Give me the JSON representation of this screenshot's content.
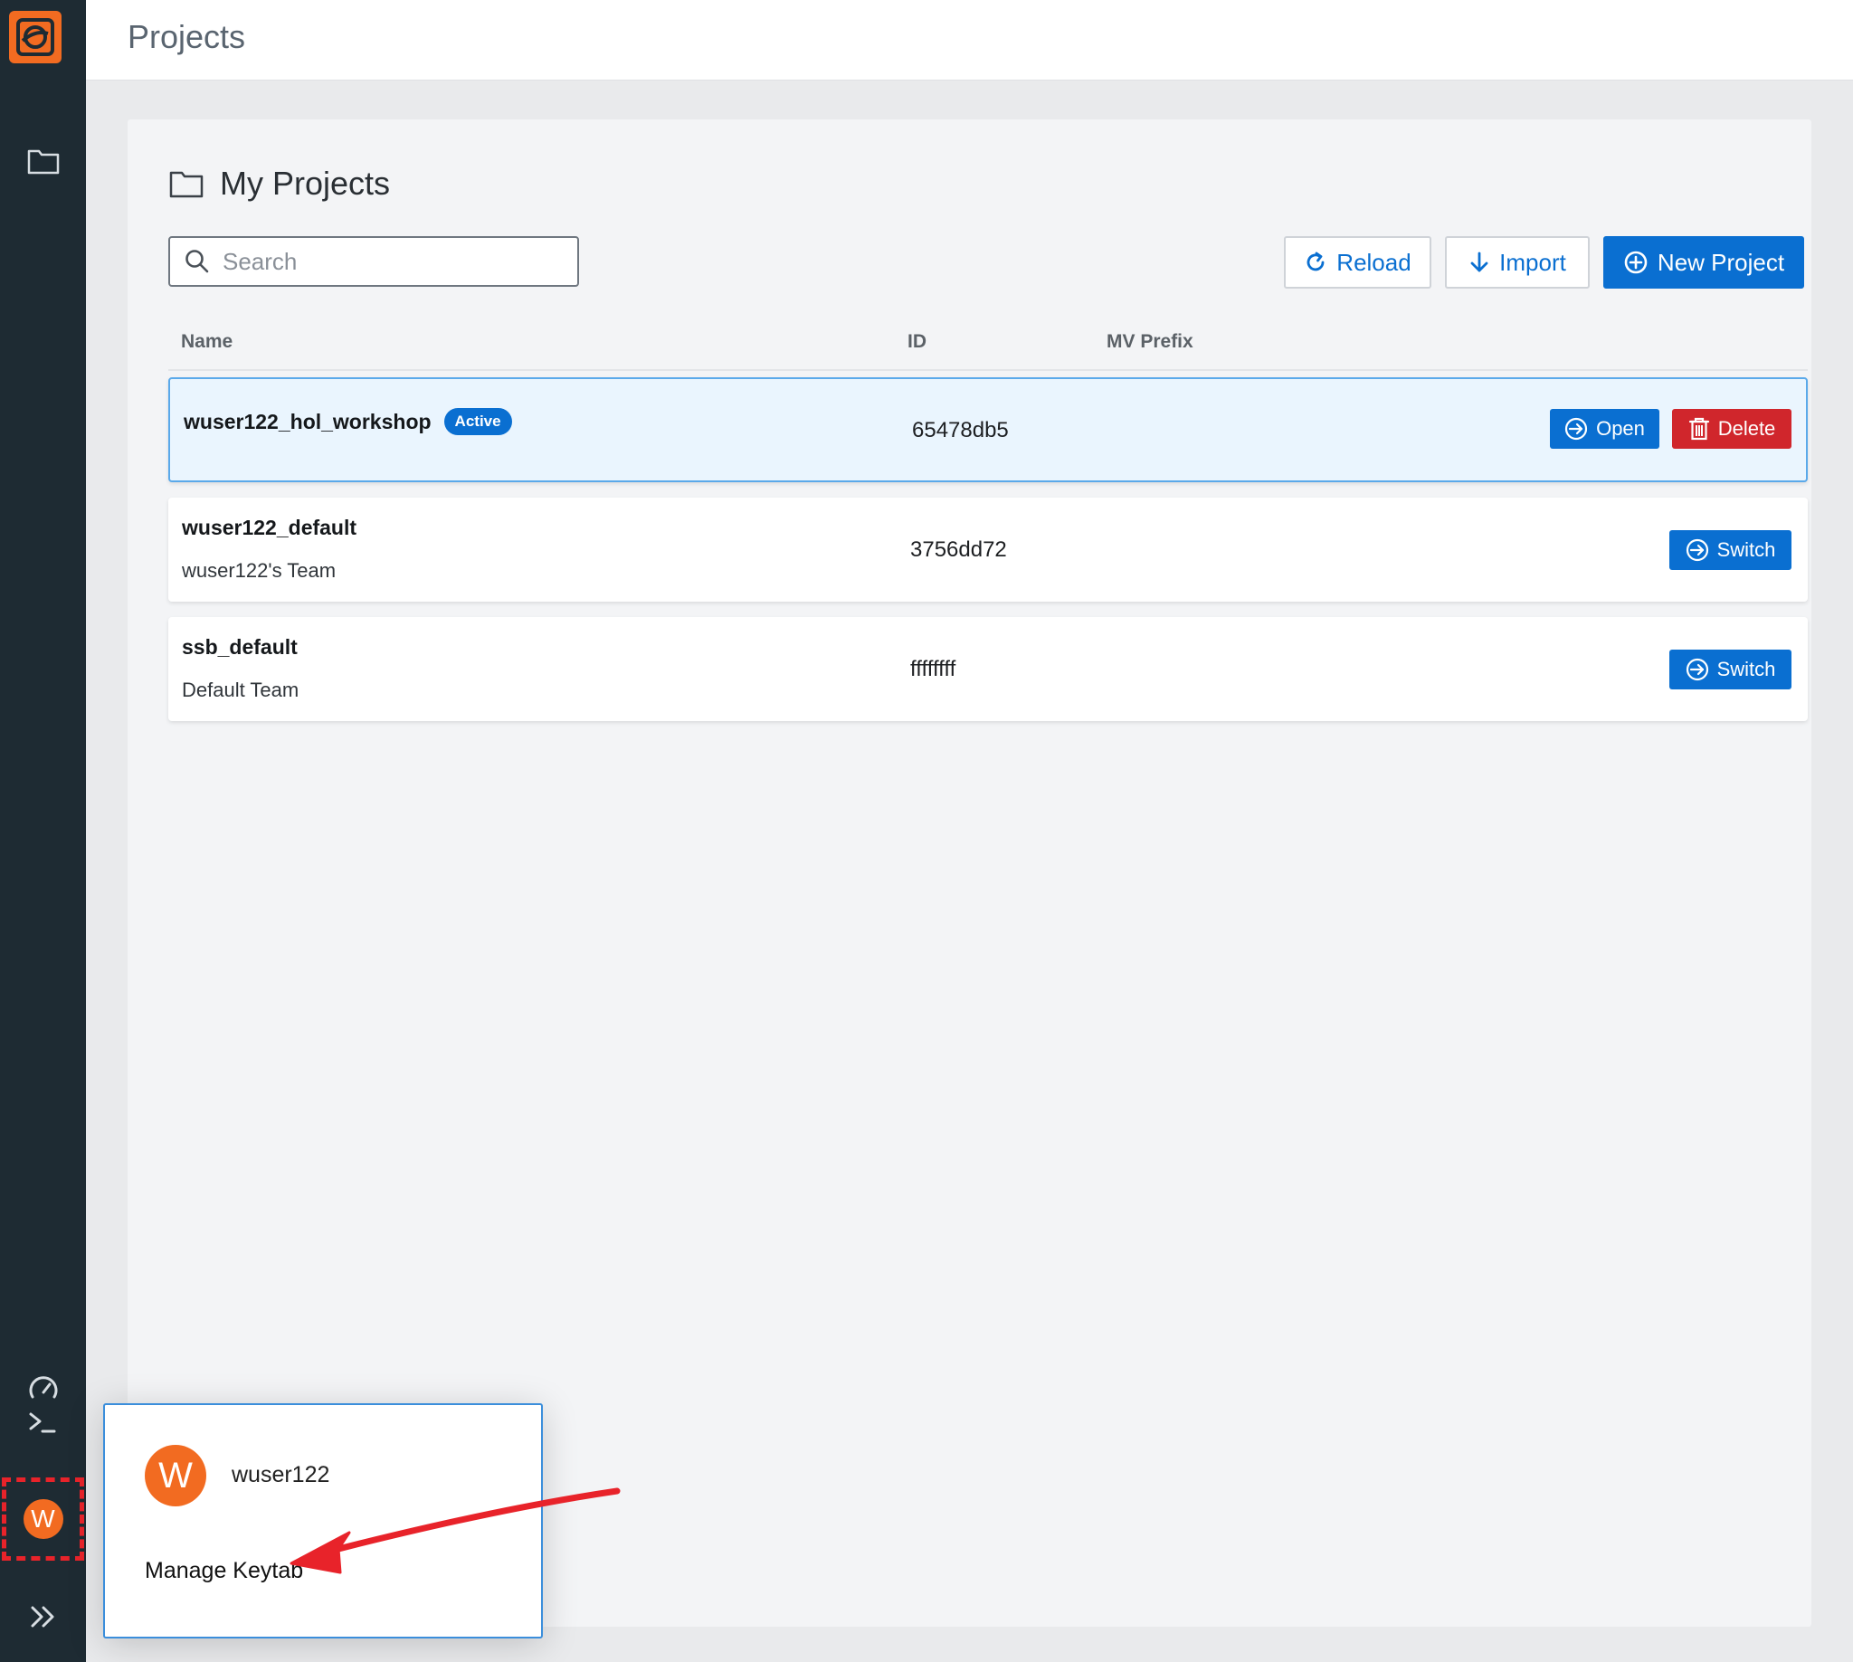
{
  "header": {
    "title": "Projects"
  },
  "sidebar": {
    "items": [
      {
        "icon": "folder-icon"
      },
      {
        "icon": "speedometer-icon"
      },
      {
        "icon": "terminal-icon"
      }
    ],
    "avatar_letter": "W",
    "expand_icon": "chevron-double-right-icon"
  },
  "main": {
    "section_title": "My Projects",
    "search": {
      "placeholder": "Search",
      "value": ""
    },
    "actions": {
      "reload": "Reload",
      "import": "Import",
      "new_project": "New Project"
    },
    "columns": [
      "Name",
      "ID",
      "MV Prefix"
    ],
    "projects": [
      {
        "name": "wuser122_hol_workshop",
        "badge": "Active",
        "team": "",
        "id": "65478db5",
        "mv_prefix": "",
        "buttons": [
          "Open",
          "Delete"
        ]
      },
      {
        "name": "wuser122_default",
        "team": "wuser122's Team",
        "id": "3756dd72",
        "mv_prefix": "",
        "buttons": [
          "Switch"
        ]
      },
      {
        "name": "ssb_default",
        "team": "Default Team",
        "id": "ffffffff",
        "mv_prefix": "",
        "buttons": [
          "Switch"
        ]
      }
    ]
  },
  "user_menu": {
    "avatar_letter": "W",
    "username": "wuser122",
    "items": [
      "Manage Keytab"
    ]
  },
  "colors": {
    "accent": "#0a6fd1",
    "danger": "#d0262c",
    "brand": "#f26b21",
    "sidebar": "#1e2b33",
    "annotation": "#e8232a"
  }
}
